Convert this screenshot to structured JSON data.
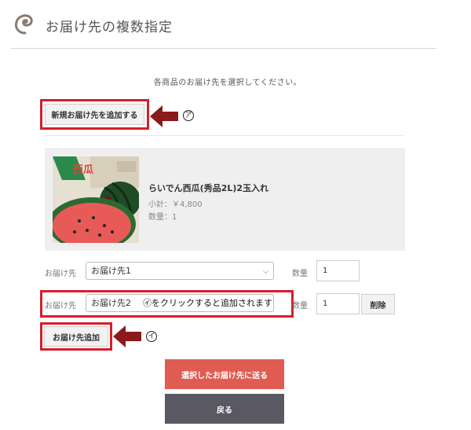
{
  "header": {
    "logo_icon": "swirl-logo-icon",
    "title": "お届け先の複数指定"
  },
  "instruction": "各商品のお届け先を選択してください。",
  "add_new_address_button": "新規お届け先を追加する",
  "callouts": {
    "a": "ア",
    "b": "イ"
  },
  "product": {
    "name": "らいでん西瓜(秀品2L)2玉入れ",
    "subtotal": "小計：￥4,800",
    "quantity": "数量：1",
    "image_box_text": "西瓜"
  },
  "delivery_rows": [
    {
      "label": "お届け先",
      "selected": "お届け先1",
      "qty_label": "数量",
      "qty": "1"
    },
    {
      "label": "お届け先",
      "selected": "お届け先2",
      "qty_label": "数量",
      "qty": "1",
      "delete_label": "削除"
    }
  ],
  "note": "㋑をクリックすると追加されます",
  "add_destination_button": "お届け先追加",
  "submit_button": "選択したお届け先に送る",
  "back_button": "戻る",
  "colors": {
    "highlight": "#d51f2b",
    "arrow": "#8b1a1a",
    "submit": "#e05c52",
    "back": "#5a5862"
  }
}
